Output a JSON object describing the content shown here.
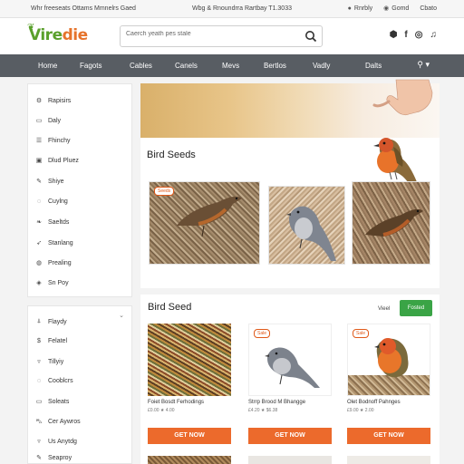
{
  "topbar": {
    "left_text": "Whr freeseats Ottams Mmnelrs Gaed",
    "mid_text": "Wbg & Rnoundrra Rartbay T1.3033",
    "right_items": [
      "Rnrbly",
      "Gomd",
      "Cbato"
    ]
  },
  "header": {
    "logo_part1": "Vire",
    "logo_part2": "die",
    "search_placeholder": "Caerch yeath pes stale",
    "social_icons": [
      "shield-icon",
      "facebook-icon",
      "instagram-icon",
      "bell-icon"
    ]
  },
  "nav": {
    "items": [
      "Home",
      "Fagots",
      "Cables",
      "Canels",
      "Mevs",
      "Bertlos",
      "Vadly",
      "Dalts"
    ],
    "account_icon": "account-icon"
  },
  "sidebar": {
    "group1": [
      {
        "icon": "gear-icon",
        "label": "Rapisirs"
      },
      {
        "icon": "doc-icon",
        "label": "Daly"
      },
      {
        "icon": "list-icon",
        "label": "Fhinchy"
      },
      {
        "icon": "box-icon",
        "label": "Dlud Pluez"
      },
      {
        "icon": "pen-icon",
        "label": "Shiye"
      },
      {
        "icon": "chat-icon",
        "label": "Cuylng"
      },
      {
        "icon": "leaf-icon",
        "label": "Saeltds"
      },
      {
        "icon": "feather-icon",
        "label": "Stanlang"
      },
      {
        "icon": "globe-icon",
        "label": "Prealing"
      },
      {
        "icon": "tag-icon",
        "label": "Sn Poy"
      }
    ],
    "group2": [
      {
        "icon": "tree-icon",
        "label": "Flaydy"
      },
      {
        "icon": "dollar-icon",
        "label": "Felatel"
      },
      {
        "icon": "cup-icon",
        "label": "Tillyiy"
      },
      {
        "icon": "chat-icon",
        "label": "Cooblcrs"
      },
      {
        "icon": "doc-icon",
        "label": "Soleats"
      },
      {
        "icon": "car-icon",
        "label": "Cer Aywros"
      },
      {
        "icon": "cup-icon",
        "label": "Us Anytdg"
      },
      {
        "icon": "pen-icon",
        "label": "Seaproy"
      }
    ]
  },
  "section1": {
    "title": "Bird Seeds",
    "badge": "Seeds"
  },
  "section2": {
    "title": "Bird Seed",
    "view_all": "Vieel",
    "pill_label": "Fosted",
    "products": [
      {
        "name": "Foiet Bosdt Ferhodings",
        "price": "£0.00   ★ 4.00",
        "badge": "",
        "button": "GET NOW"
      },
      {
        "name": "Strrp Brood M Bhangge",
        "price": "£4.20   ★ $6.38",
        "badge": "Sale",
        "button": "GET NOW"
      },
      {
        "name": "Olet Bodnoff Pahnges",
        "price": "£9.00   ★ 2.00",
        "badge": "Sale",
        "button": "GET NOW"
      }
    ]
  },
  "colors": {
    "brand_green": "#5aa02c",
    "brand_orange": "#e6732b",
    "nav_bg": "#585d63",
    "button_orange": "#ec6a2c",
    "pill_green": "#3aa446"
  }
}
